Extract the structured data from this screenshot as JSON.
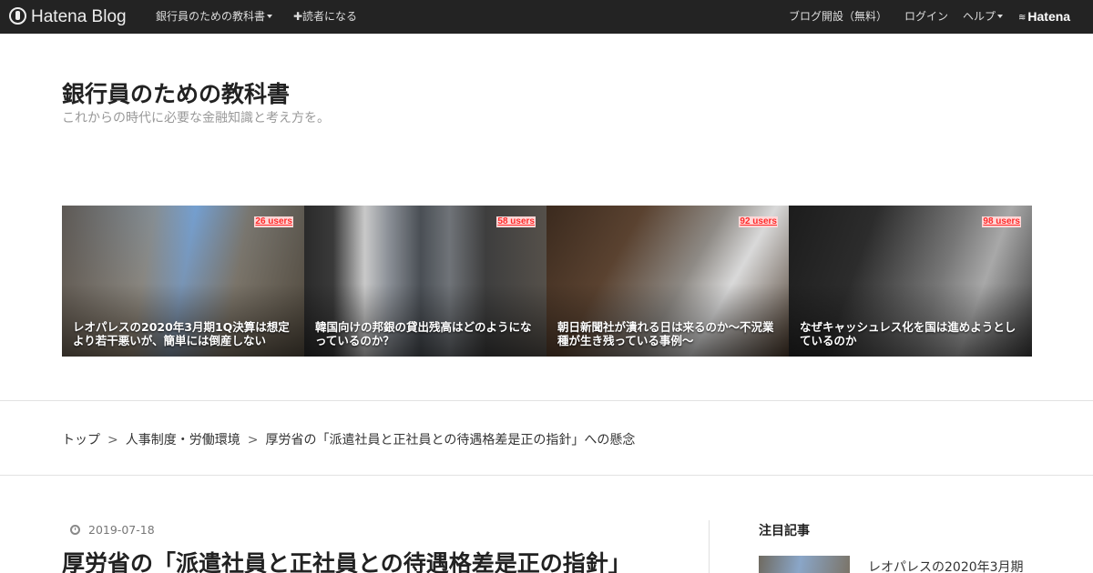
{
  "topbar": {
    "logo": "Hatena Blog",
    "blog_menu": "銀行員のための教科書",
    "subscribe": "✚読者になる",
    "signup": "ブログ開設（無料）",
    "login": "ログイン",
    "help": "ヘルプ",
    "brand": "Hatena"
  },
  "header": {
    "title": "銀行員のための教科書",
    "description": "これからの時代に必要な金融知識と考え方を。"
  },
  "featured": [
    {
      "users": "26 users",
      "title": "レオパレスの2020年3月期1Q決算は想定より若干悪いが、簡単には倒産しない"
    },
    {
      "users": "58 users",
      "title": "韓国向けの邦銀の貸出残高はどのようになっているのか？"
    },
    {
      "users": "92 users",
      "title": "朝日新聞社が潰れる日は来るのか～不況業種が生き残っている事例～"
    },
    {
      "users": "98 users",
      "title": "なぜキャッシュレス化を国は進めようとしているのか"
    }
  ],
  "breadcrumb": {
    "items": [
      "トップ",
      "人事制度・労働環境",
      "厚労省の「派遣社員と正社員との待遇格差是正の指針」への懸念"
    ],
    "separator": ">"
  },
  "article": {
    "date": "2019-07-18",
    "title": "厚労省の「派遣社員と正社員との待遇格差是正の指針」"
  },
  "sidebar": {
    "heading": "注目記事",
    "items": [
      {
        "title": "レオパレスの2020年3月期"
      }
    ]
  }
}
